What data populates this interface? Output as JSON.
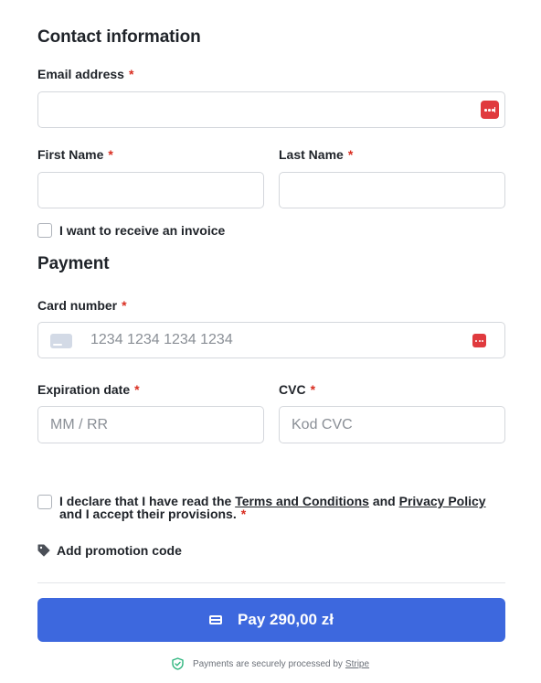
{
  "contact": {
    "heading": "Contact information",
    "email_label": "Email address",
    "email_value": "",
    "first_name_label": "First Name",
    "last_name_label": "Last Name",
    "invoice_label": "I want to receive an invoice"
  },
  "payment": {
    "heading": "Payment",
    "card_number_label": "Card number",
    "card_number_placeholder": "1234 1234 1234 1234",
    "expiration_label": "Expiration date",
    "expiration_placeholder": "MM / RR",
    "cvc_label": "CVC",
    "cvc_placeholder": "Kod CVC"
  },
  "required_marker": "*",
  "terms": {
    "prefix": "I declare that I have read the",
    "terms_link": "Terms and Conditions",
    "and": "and",
    "privacy_link": "Privacy Policy",
    "suffix": "and I accept their provisions."
  },
  "promo_label": "Add promotion code",
  "pay_button_label": "Pay 290,00 zł",
  "footer": {
    "text": "Payments are securely processed by",
    "link": "Stripe"
  },
  "colors": {
    "accent": "#3d68de",
    "required": "#d92d20",
    "password_manager_icon": "#e03a3e",
    "secure_shield": "#2fb57e"
  },
  "icons": [
    "password-manager-icon",
    "card-brand-icon",
    "tag-icon",
    "credit-card-icon",
    "shield-check-icon"
  ]
}
